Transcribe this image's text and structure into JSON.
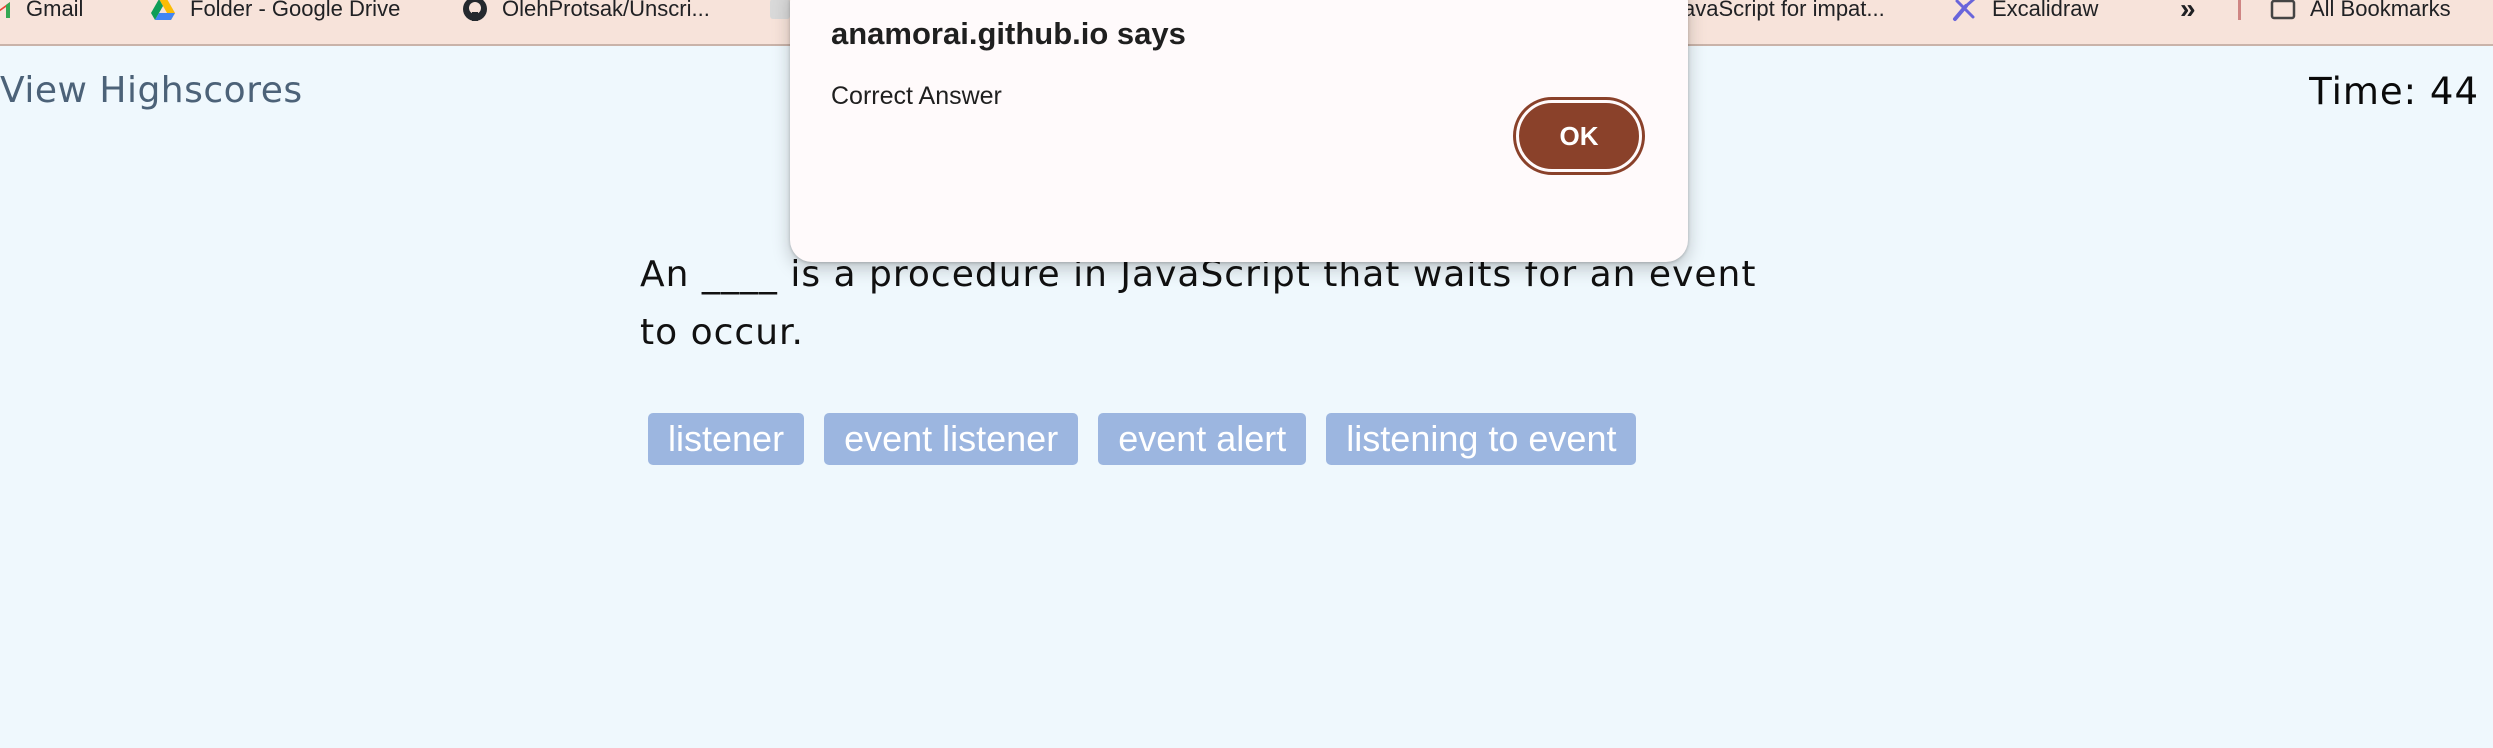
{
  "bookmarks": [
    {
      "label": "Gmail",
      "icon": "gmail-icon"
    },
    {
      "label": "Folder - Google Drive",
      "icon": "google-drive-icon"
    },
    {
      "label": "OlehProtsak/Unscri...",
      "icon": "github-icon"
    },
    {
      "label": "JavaScript for impat...",
      "icon": "bookmark-icon"
    },
    {
      "label": "Excalidraw",
      "icon": "excalidraw-icon"
    },
    {
      "label": "»",
      "icon": "more-chevron-icon"
    },
    {
      "label": "All Bookmarks",
      "icon": "folder-icon"
    }
  ],
  "header": {
    "highscores_label": "View Highscores",
    "timer_label": "Time:",
    "timer_value": "44"
  },
  "quiz": {
    "question": "An ____ is a procedure in JavaScript that waits for an event to occur.",
    "choices": [
      "listener",
      "event listener",
      "event alert",
      "listening to event"
    ]
  },
  "dialog": {
    "title": "anamorai.github.io says",
    "message": "Correct Answer",
    "ok_label": "OK"
  },
  "colors": {
    "page_background": "#eff8fd",
    "bookmarks_bar": "#f7e3da",
    "choice_button": "#9cb6e0",
    "ok_button": "#8a412a",
    "highscores_link": "#4c6278"
  }
}
